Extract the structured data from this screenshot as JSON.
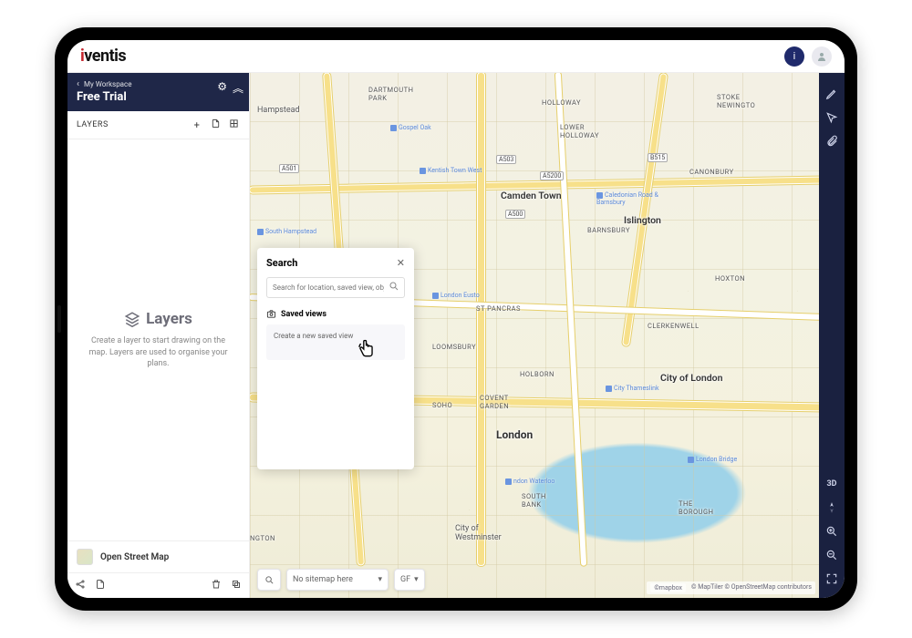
{
  "brand": {
    "name": "iventis"
  },
  "workspace": {
    "breadcrumb": "My Workspace",
    "title": "Free Trial"
  },
  "sidebar": {
    "layers_label": "LAYERS",
    "empty_title": "Layers",
    "empty_desc": "Create a layer to start drawing on the map. Layers are used to organise your plans.",
    "basemap": "Open Street Map"
  },
  "search_panel": {
    "title": "Search",
    "placeholder": "Search for location, saved view, object",
    "section_label": "Saved views",
    "create_row": "Create a new saved view"
  },
  "bottom_bar": {
    "sitemap_value": "No sitemap here",
    "floor_value": "GF"
  },
  "right_rail": {
    "mode3d": "3D"
  },
  "map": {
    "attribution_logo": "©mapbox",
    "attribution": "© MapTiler © OpenStreetMap contributors",
    "labels": {
      "hampstead": "Hampstead",
      "camden": "Camden Town",
      "islington": "Islington",
      "london": "London",
      "city_of_london": "City of London",
      "westminster": "City of\nWestminster",
      "dartmouth": "DARTMOUTH\nPARK",
      "holloway": "HOLLOWAY",
      "lower_holloway": "LOWER\nHOLLOWAY",
      "stoke": "STOKE\nNEWINGTO",
      "canonbury": "CANONBURY",
      "barnsbury": "BARNSBURY",
      "hoxton": "HOXTON",
      "clerkenwell": "CLERKENWELL",
      "st_pancras": "ST PANCRAS",
      "holborn": "HOLBORN",
      "covent": "COVENT\nGARDEN",
      "south_bank": "SOUTH\nBANK",
      "borough": "THE\nBOROUGH",
      "newington": "NGTON",
      "soho": "SOHO",
      "bloomsbury": "LOOMSBURY"
    },
    "pois": {
      "gospel_oak": "Gospel Oak",
      "kentish_town_west": "Kentish Town West",
      "south_hampstead": "South Hampstead",
      "caledonian": "Caledonian Road &\nBarnsbury",
      "london_bridge": "London Bridge",
      "waterloo": "ndon Waterloo",
      "thameslink": "City Thameslink",
      "euston": "London Eusto"
    },
    "shields": {
      "a503": "A503",
      "b515": "B515",
      "a5200": "A5200",
      "a501": "A501",
      "a500": "A500"
    }
  }
}
